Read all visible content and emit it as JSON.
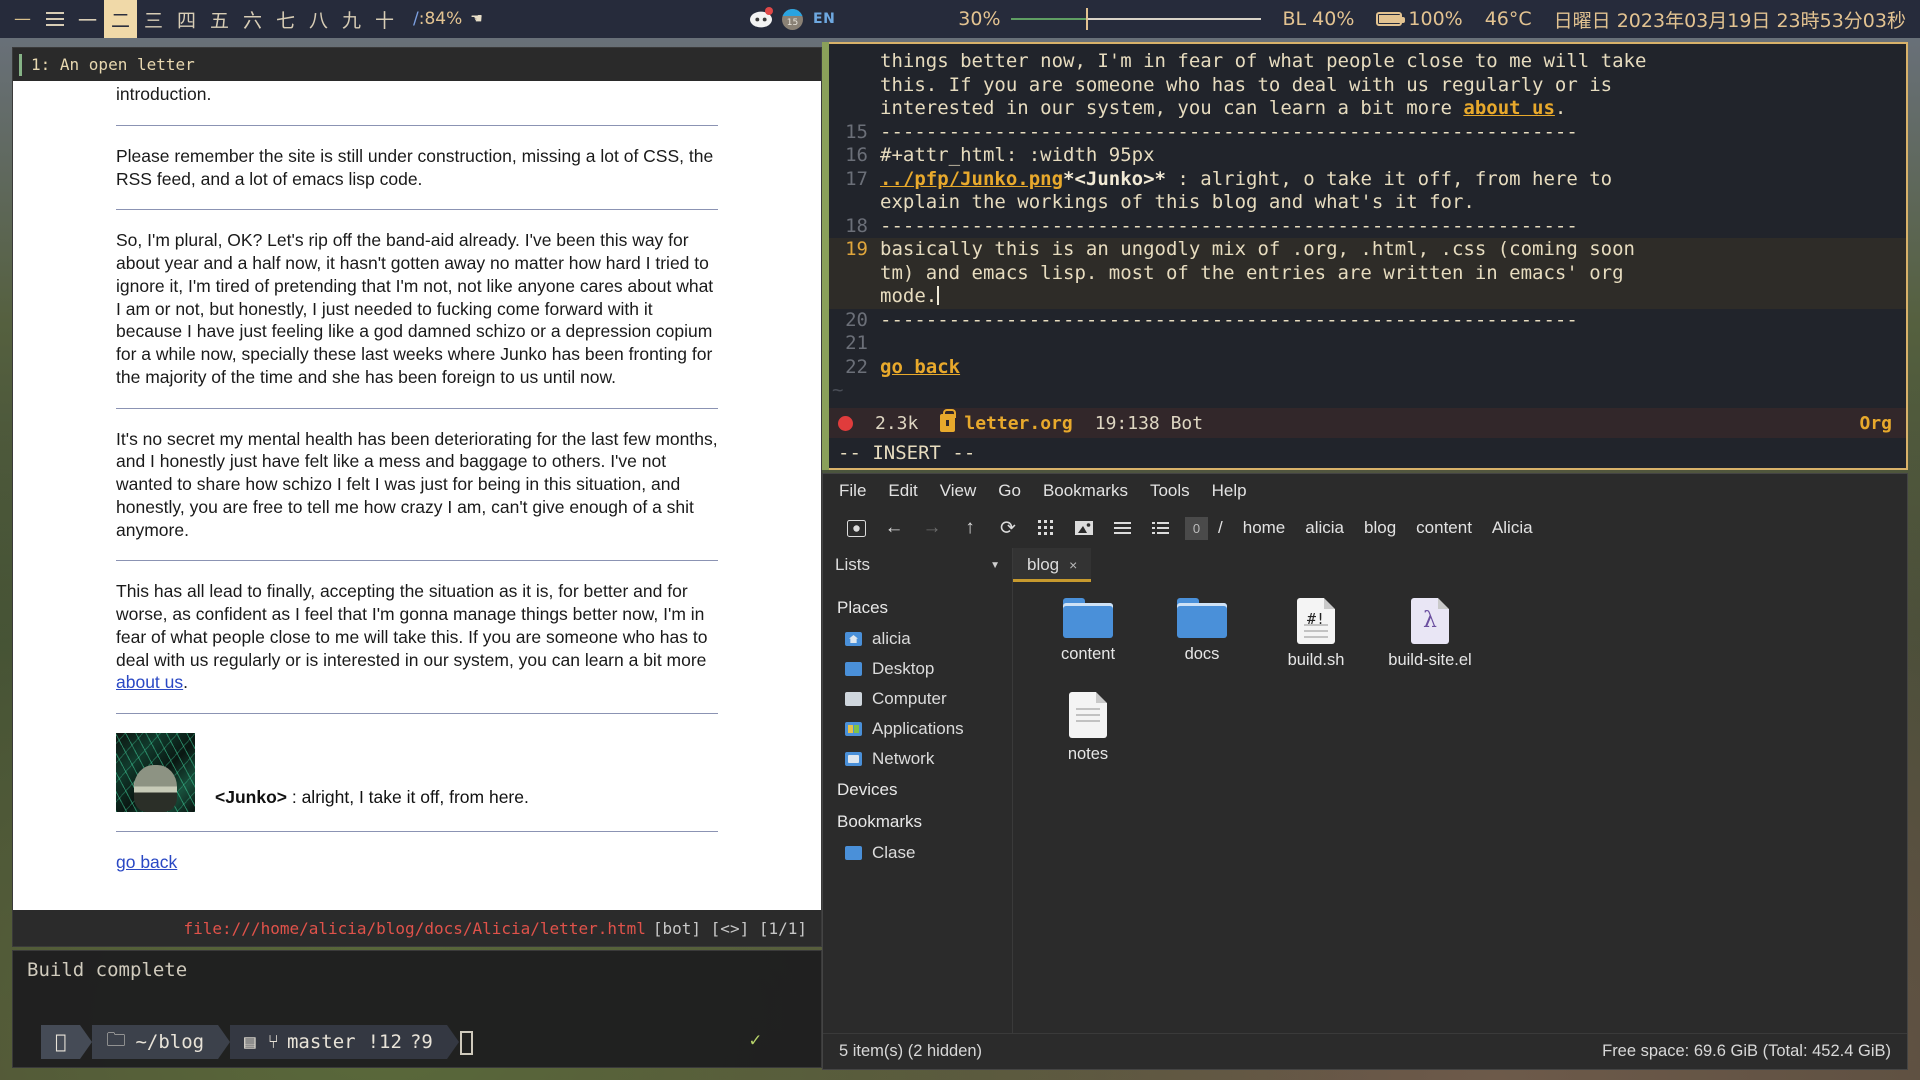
{
  "topbar": {
    "workspaces": [
      "一",
      "二",
      "三",
      "四",
      "五",
      "六",
      "七",
      "八",
      "九",
      "十"
    ],
    "active_workspace_index": 1,
    "menu_icon": "hamburger-icon",
    "zoom_label": "/:84%",
    "zoom_slash": "/",
    "zoom_value": ":84%",
    "pointer_icon": "cursor-icon",
    "tray": {
      "discord_icon": "discord-icon",
      "app_badge": "15",
      "language": "EN"
    },
    "volume": {
      "percent_label": "30%",
      "percent": 30
    },
    "backlight": "BL 40%",
    "battery": "100%",
    "temperature": "46°C",
    "clock": "日曜日 2023年03月19日 23時53分03秒"
  },
  "browser": {
    "tab_title": "1: An open letter",
    "paragraph_cut": "introduction.",
    "paragraph_1": "Please remember the site is still under construction, missing a lot of CSS, the RSS feed, and a lot of emacs lisp code.",
    "paragraph_2": "So, I'm plural, OK? Let's rip off the band-aid already. I've been this way for about year and a half now, it hasn't gotten away no matter how hard I tried to ignore it, I'm tired of pretending that I'm not, not like anyone cares about what I am or not, but honestly, I just needed to fucking come forward with it because I have just feeling like a god damned schizo or a depression copium for a while now, specially these last weeks where Junko has been fronting for the majority of the time and she has been foreign to us until now.",
    "paragraph_3": "It's no secret my mental health has been deteriorating for the last few months, and I honestly just have felt like a mess and baggage to others. I've not wanted to share how schizo I felt I was just for being in this situation, and honestly, you are free to tell me how crazy I am, can't give enough of a shit anymore.",
    "paragraph_4_a": "This has all lead to finally, accepting the situation as it is, for better and for worse, as confident as I feel that I'm gonna manage things better now, I'm in fear of what people close to me will take this. If you are someone who has to deal with us regularly or is interested in our system, you can learn a bit more ",
    "paragraph_4_link": "about us",
    "paragraph_4_b": ".",
    "pfp_alt": "junko-avatar",
    "caption_name": "<Junko>",
    "caption_text": " : alright, I take it off, from here.",
    "go_back": "go back",
    "status_url": "file:///home/alicia/blog/docs/Alicia/letter.html",
    "status_flags": "[bot] [<>] [1/1]"
  },
  "terminal": {
    "output": "Build complete",
    "seg_distro_icon": "linux-penguin-icon",
    "seg_folder_icon": "folder-icon",
    "path": "~/blog",
    "seg_branch_icon": "git-branch-icon",
    "branch": "master",
    "modified": "!12",
    "untracked": "?9",
    "check": "✓"
  },
  "emacs": {
    "lines": [
      {
        "num": "",
        "text": "things better now, I'm in fear of what people close to me will take",
        "kind": "wrap"
      },
      {
        "num": "",
        "text": "this. If you are someone who has to deal with us regularly or is",
        "kind": "wrap"
      },
      {
        "num": "",
        "text": "interested in our system, you can learn a bit more ",
        "kind": "wrap-link",
        "link": "about us",
        "tail": "."
      },
      {
        "num": "15",
        "text": "-------------------------------------------------------------",
        "kind": "rule"
      },
      {
        "num": "16",
        "text": "#+attr_html: :width 95px",
        "kind": "plain"
      },
      {
        "num": "17",
        "text": "",
        "kind": "image-line",
        "link": "../pfp/Junko.png",
        "bold": "*<Junko>*",
        "tail": " : alright, o take it off, from here to"
      },
      {
        "num": "",
        "text": "explain the workings of this blog and what's it for.",
        "kind": "wrap"
      },
      {
        "num": "18",
        "text": "-------------------------------------------------------------",
        "kind": "rule"
      },
      {
        "num": "19",
        "text": "basically this is an ungodly mix of .org, .html, .css (coming soon",
        "kind": "current"
      },
      {
        "num": "",
        "text": "tm) and emacs lisp. most of the entries are written in emacs' org",
        "kind": "current"
      },
      {
        "num": "",
        "text": "mode.",
        "kind": "current-cursor"
      },
      {
        "num": "20",
        "text": "-------------------------------------------------------------",
        "kind": "rule"
      },
      {
        "num": "21",
        "text": "",
        "kind": "plain"
      },
      {
        "num": "22",
        "text": "",
        "kind": "link-line",
        "link": "go back"
      }
    ],
    "tilde": "~",
    "modeline": {
      "unsaved_icon": "modified-dot-icon",
      "size": "2.3k",
      "lock_icon": "lock-icon",
      "filename": "letter.org",
      "position": "19:138 Bot",
      "major_mode": "Org"
    },
    "echo": "-- INSERT --"
  },
  "filemanager": {
    "menu": [
      "File",
      "Edit",
      "View",
      "Go",
      "Bookmarks",
      "Tools",
      "Help"
    ],
    "toolbar_icons": [
      "open-terminal-icon",
      "back-arrow-icon",
      "forward-arrow-icon",
      "up-arrow-icon",
      "reload-icon",
      "icon-view-icon",
      "thumbnail-view-icon",
      "compact-view-icon",
      "detail-view-icon"
    ],
    "path_box": "0",
    "breadcrumbs": [
      "/",
      "home",
      "alicia",
      "blog",
      "content",
      "Alicia"
    ],
    "list_selector": "Lists",
    "tabs": [
      {
        "label": "blog",
        "close": "×",
        "active": true
      }
    ],
    "sidebar": {
      "places_header": "Places",
      "places": [
        {
          "label": "alicia",
          "icon": "home-folder-icon"
        },
        {
          "label": "Desktop",
          "icon": "desktop-folder-icon"
        },
        {
          "label": "Computer",
          "icon": "computer-icon"
        },
        {
          "label": "Applications",
          "icon": "applications-icon"
        },
        {
          "label": "Network",
          "icon": "network-icon"
        }
      ],
      "devices_header": "Devices",
      "bookmarks_header": "Bookmarks",
      "bookmarks": [
        {
          "label": "Clase",
          "icon": "folder-icon"
        }
      ]
    },
    "files": [
      {
        "name": "content",
        "type": "folder"
      },
      {
        "name": "docs",
        "type": "folder"
      },
      {
        "name": "build.sh",
        "type": "script"
      },
      {
        "name": "build-site.el",
        "type": "elisp"
      },
      {
        "name": "notes",
        "type": "document"
      }
    ],
    "status_left": "5 item(s) (2 hidden)",
    "status_right": "Free space: 69.6 GiB (Total: 452.4 GiB)"
  },
  "colors": {
    "accent_gold": "#e8a92c",
    "topbar_bg": "#262b3b",
    "topbar_fg": "#e3c391",
    "link_blue": "#2a48c4",
    "folder_blue": "#4a90d9",
    "error_red": "#e0524a"
  }
}
